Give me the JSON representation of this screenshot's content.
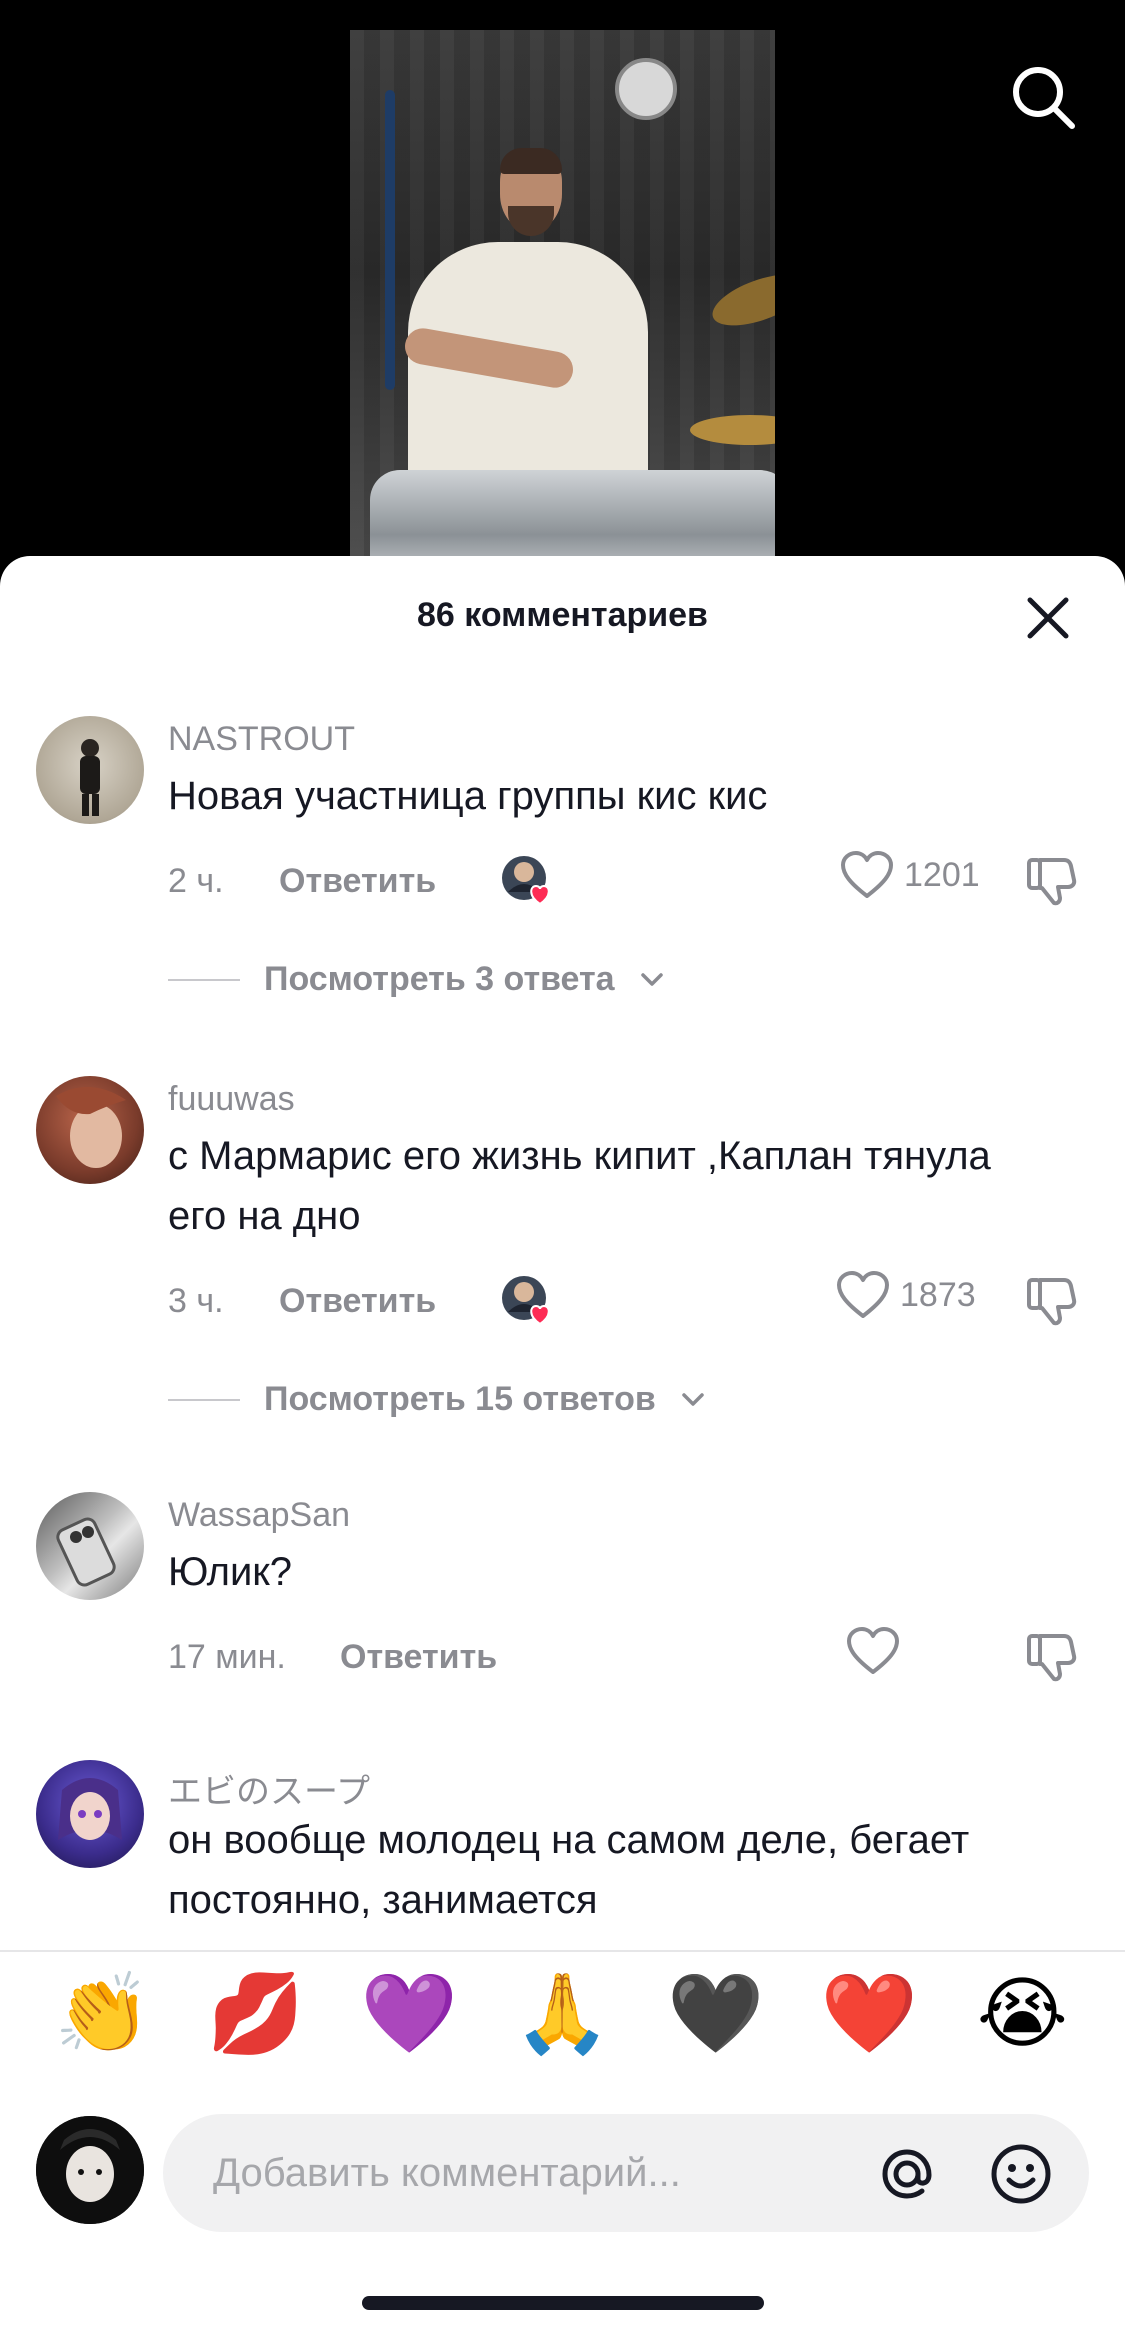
{
  "sheet": {
    "title": "86 комментариев"
  },
  "comments": [
    {
      "username": "NASTROUT",
      "text": "Новая участница группы кис кис",
      "time": "2 ч.",
      "reply_label": "Ответить",
      "creator_liked": true,
      "likes": "1201",
      "view_replies": "Посмотреть 3 ответа"
    },
    {
      "username": "fuuuwas",
      "text": "с Мармарис его жизнь кипит ,Каплан тянула его на дно",
      "time": "3 ч.",
      "reply_label": "Ответить",
      "creator_liked": true,
      "likes": "1873",
      "view_replies": "Посмотреть 15 ответов"
    },
    {
      "username": "WassapSan",
      "text": "Юлик?",
      "time": "17 мин.",
      "reply_label": "Ответить",
      "creator_liked": false,
      "likes": ""
    },
    {
      "username": "エビのスープ",
      "text": "он вообще молодец на самом деле, бегает постоянно, занимается"
    }
  ],
  "emoji_bar": [
    "👏",
    "💋",
    "💜",
    "🙏",
    "🖤",
    "❤️",
    "😭"
  ],
  "input": {
    "placeholder": "Добавить комментарий..."
  },
  "colors": {
    "text_primary": "#161823",
    "text_secondary": "#8a8b91",
    "heart_red": "#fe2c55"
  }
}
